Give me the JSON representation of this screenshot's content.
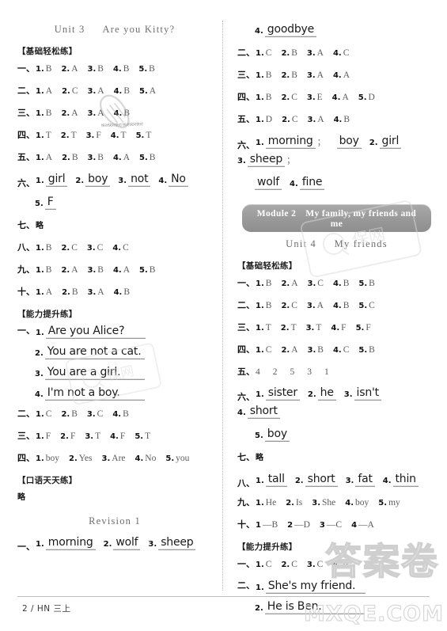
{
  "page": {
    "folio": "2 / HN 三上",
    "watermarks": {
      "carrot_text": "快对快对快对 快对快对快对",
      "card_text": "Q保网",
      "answer_text": "答案卷",
      "site": "MXQE.COM"
    }
  },
  "left": {
    "unit_title_a": "Unit 3",
    "unit_title_b": "Are you Kitty?",
    "basic_head": "【基础轻松练】",
    "basic": [
      {
        "cn": "一、",
        "answers": [
          {
            "n": "1.",
            "v": "B"
          },
          {
            "n": "2.",
            "v": "A"
          },
          {
            "n": "3.",
            "v": "B"
          },
          {
            "n": "4.",
            "v": "B"
          },
          {
            "n": "5.",
            "v": "B"
          }
        ]
      },
      {
        "cn": "二、",
        "answers": [
          {
            "n": "1.",
            "v": "A"
          },
          {
            "n": "2.",
            "v": "C"
          },
          {
            "n": "3.",
            "v": "A"
          },
          {
            "n": "4.",
            "v": "B"
          },
          {
            "n": "5.",
            "v": "A"
          }
        ]
      },
      {
        "cn": "三、",
        "answers": [
          {
            "n": "1.",
            "v": "B"
          },
          {
            "n": "2.",
            "v": "A"
          },
          {
            "n": "3.",
            "v": "A"
          },
          {
            "n": "4.",
            "v": "B"
          }
        ]
      },
      {
        "cn": "四、",
        "answers": [
          {
            "n": "1.",
            "v": "T"
          },
          {
            "n": "2.",
            "v": "T"
          },
          {
            "n": "3.",
            "v": "F"
          },
          {
            "n": "4.",
            "v": "T"
          },
          {
            "n": "5.",
            "v": "T"
          }
        ]
      },
      {
        "cn": "五、",
        "answers": [
          {
            "n": "1.",
            "v": "A"
          },
          {
            "n": "2.",
            "v": "B"
          },
          {
            "n": "3.",
            "v": "B"
          },
          {
            "n": "4.",
            "v": "A"
          },
          {
            "n": "5.",
            "v": "B"
          }
        ]
      }
    ],
    "six_cn": "六、",
    "six_line1": [
      {
        "n": "1.",
        "w": "girl"
      },
      {
        "n": "2.",
        "w": "boy"
      },
      {
        "n": "3.",
        "w": "not"
      },
      {
        "n": "4.",
        "w": "No"
      }
    ],
    "six_line2": [
      {
        "n": "5.",
        "w": "F"
      }
    ],
    "seven_cn": "七、",
    "seven_val": "略",
    "basic2": [
      {
        "cn": "八、",
        "answers": [
          {
            "n": "1.",
            "v": "B"
          },
          {
            "n": "2.",
            "v": "C"
          },
          {
            "n": "3.",
            "v": "C"
          },
          {
            "n": "4.",
            "v": "C"
          }
        ]
      },
      {
        "cn": "九、",
        "answers": [
          {
            "n": "1.",
            "v": "B"
          },
          {
            "n": "2.",
            "v": "A"
          },
          {
            "n": "3.",
            "v": "B"
          },
          {
            "n": "4.",
            "v": "A"
          },
          {
            "n": "5.",
            "v": "B"
          }
        ]
      },
      {
        "cn": "十、",
        "answers": [
          {
            "n": "1.",
            "v": "A"
          },
          {
            "n": "2.",
            "v": "B"
          },
          {
            "n": "3.",
            "v": "A"
          },
          {
            "n": "4.",
            "v": "B"
          }
        ]
      }
    ],
    "ability_head": "【能力提升练】",
    "ability_one_cn": "一、",
    "ability_sentences": [
      {
        "n": "1.",
        "w": "Are you Alice?"
      },
      {
        "n": "2.",
        "w": "You are not a cat."
      },
      {
        "n": "3.",
        "w": "You are a girl."
      },
      {
        "n": "4.",
        "w": "I'm not a boy."
      }
    ],
    "ability_rows": [
      {
        "cn": "二、",
        "answers": [
          {
            "n": "1.",
            "v": "C"
          },
          {
            "n": "2.",
            "v": "B"
          },
          {
            "n": "3.",
            "v": "C"
          },
          {
            "n": "4.",
            "v": "B"
          }
        ]
      },
      {
        "cn": "三、",
        "answers": [
          {
            "n": "1.",
            "v": "F"
          },
          {
            "n": "2.",
            "v": "F"
          },
          {
            "n": "3.",
            "v": "T"
          },
          {
            "n": "4.",
            "v": "F"
          },
          {
            "n": "5.",
            "v": "T"
          }
        ]
      },
      {
        "cn": "四、",
        "answers": [
          {
            "n": "1.",
            "v": "boy"
          },
          {
            "n": "2.",
            "v": "Yes"
          },
          {
            "n": "3.",
            "v": "Are"
          },
          {
            "n": "4.",
            "v": "No"
          },
          {
            "n": "5.",
            "v": "you"
          }
        ]
      }
    ],
    "oral_head": "【口语天天练】",
    "oral_val": "略",
    "revision_title": "Revision 1",
    "revision_cn": "一、",
    "revision_words": [
      {
        "n": "1.",
        "w": "morning"
      },
      {
        "n": "2.",
        "w": "wolf"
      },
      {
        "n": "3.",
        "w": "sheep"
      }
    ]
  },
  "right": {
    "top_word": {
      "n": "4.",
      "w": "goodbye"
    },
    "top_rows": [
      {
        "cn": "二、",
        "answers": [
          {
            "n": "1.",
            "v": "C"
          },
          {
            "n": "2.",
            "v": "B"
          },
          {
            "n": "3.",
            "v": "A"
          },
          {
            "n": "4.",
            "v": "C"
          }
        ]
      },
      {
        "cn": "三、",
        "answers": [
          {
            "n": "1.",
            "v": "B"
          },
          {
            "n": "2.",
            "v": "B"
          },
          {
            "n": "3.",
            "v": "A"
          },
          {
            "n": "4.",
            "v": "A"
          }
        ]
      },
      {
        "cn": "四、",
        "answers": [
          {
            "n": "1.",
            "v": "B"
          },
          {
            "n": "2.",
            "v": "C"
          },
          {
            "n": "3.",
            "v": "E"
          },
          {
            "n": "4.",
            "v": "A"
          },
          {
            "n": "5.",
            "v": "D"
          }
        ]
      },
      {
        "cn": "五、",
        "answers": [
          {
            "n": "1.",
            "v": "D"
          },
          {
            "n": "2.",
            "v": "C"
          },
          {
            "n": "3.",
            "v": "A"
          },
          {
            "n": "4.",
            "v": "B"
          }
        ]
      }
    ],
    "six_cn": "六、",
    "six_line1": [
      {
        "n": "1.",
        "w": "morning",
        "sep": "；"
      },
      {
        "n": "",
        "w": "boy",
        "sep": ""
      },
      {
        "n": "2.",
        "w": "girl",
        "sep": ""
      },
      {
        "n": "3.",
        "w": "sheep",
        "sep": "；"
      }
    ],
    "six_line2": [
      {
        "n": "",
        "w": "wolf"
      },
      {
        "n": "4.",
        "w": "fine"
      }
    ],
    "module_banner": "Module 2　My family, my friends and me",
    "unit_title_a": "Unit 4",
    "unit_title_b": "My friends",
    "basic_head": "【基础轻松练】",
    "basic": [
      {
        "cn": "一、",
        "answers": [
          {
            "n": "1.",
            "v": "B"
          },
          {
            "n": "2.",
            "v": "A"
          },
          {
            "n": "3.",
            "v": "C"
          },
          {
            "n": "4.",
            "v": "B"
          },
          {
            "n": "5.",
            "v": "B"
          }
        ]
      },
      {
        "cn": "二、",
        "answers": [
          {
            "n": "1.",
            "v": "B"
          },
          {
            "n": "2.",
            "v": "C"
          },
          {
            "n": "3.",
            "v": "A"
          },
          {
            "n": "4.",
            "v": "B"
          },
          {
            "n": "5.",
            "v": "C"
          }
        ]
      },
      {
        "cn": "三、",
        "answers": [
          {
            "n": "1.",
            "v": "T"
          },
          {
            "n": "2.",
            "v": "T"
          },
          {
            "n": "3.",
            "v": "T"
          },
          {
            "n": "4.",
            "v": "F"
          },
          {
            "n": "5.",
            "v": "F"
          }
        ]
      },
      {
        "cn": "四、",
        "answers": [
          {
            "n": "1.",
            "v": "C"
          },
          {
            "n": "2.",
            "v": "A"
          },
          {
            "n": "3.",
            "v": "B"
          },
          {
            "n": "4.",
            "v": "C"
          },
          {
            "n": "5.",
            "v": "B"
          }
        ]
      }
    ],
    "five_cn": "五、",
    "five_seq": [
      "4",
      "2",
      "5",
      "3",
      "1"
    ],
    "six2_cn": "六、",
    "six2_line1": [
      {
        "n": "1.",
        "w": "sister"
      },
      {
        "n": "2.",
        "w": "he"
      },
      {
        "n": "3.",
        "w": "isn't"
      },
      {
        "n": "4.",
        "w": "short"
      }
    ],
    "six2_line2": [
      {
        "n": "5.",
        "w": "boy"
      }
    ],
    "seven_cn": "七、",
    "seven_val": "略",
    "eight_cn": "八、",
    "eight_words": [
      {
        "n": "1.",
        "w": "tall"
      },
      {
        "n": "2.",
        "w": "short"
      },
      {
        "n": "3.",
        "w": "fat"
      },
      {
        "n": "4.",
        "w": "thin"
      }
    ],
    "tail_rows": [
      {
        "cn": "九、",
        "answers": [
          {
            "n": "1.",
            "v": "He"
          },
          {
            "n": "2.",
            "v": "Is"
          },
          {
            "n": "3.",
            "v": "She"
          },
          {
            "n": "4.",
            "v": "boy"
          },
          {
            "n": "5.",
            "v": "my"
          }
        ]
      },
      {
        "cn": "十、",
        "answers": [
          {
            "n": "1",
            "v": "—B"
          },
          {
            "n": "2",
            "v": "—D"
          },
          {
            "n": "3",
            "v": "—C"
          },
          {
            "n": "4",
            "v": "—A"
          }
        ]
      }
    ],
    "ability_head": "【能力提升练】",
    "ability_rows": [
      {
        "cn": "一、",
        "answers": [
          {
            "n": "1.",
            "v": "C"
          },
          {
            "n": "2.",
            "v": "C"
          },
          {
            "n": "3.",
            "v": "C"
          },
          {
            "n": "4.",
            "v": "B"
          }
        ]
      }
    ],
    "ability_two_cn": "二、",
    "ability_sentences": [
      {
        "n": "1.",
        "w": "She's my friend."
      },
      {
        "n": "2.",
        "w": "He is Ben."
      }
    ]
  }
}
